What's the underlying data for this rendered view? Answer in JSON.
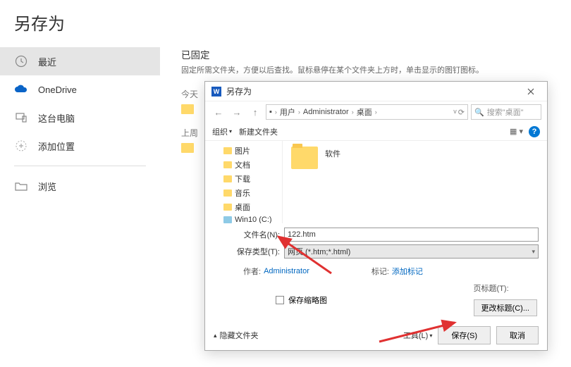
{
  "page": {
    "title": "另存为"
  },
  "sidebar": {
    "items": [
      {
        "label": "最近"
      },
      {
        "label": "OneDrive"
      },
      {
        "label": "这台电脑"
      },
      {
        "label": "添加位置"
      },
      {
        "label": "浏览"
      }
    ]
  },
  "right": {
    "pinned_title": "已固定",
    "pinned_sub": "固定所需文件夹，方便以后查找。鼠标悬停在某个文件夹上方时，单击显示的图钉图标。",
    "today": "今天",
    "lastweek": "上周"
  },
  "dialog": {
    "title": "另存为",
    "breadcrumb": [
      "用户",
      "Administrator",
      "桌面"
    ],
    "search_placeholder": "搜索\"桌面\"",
    "organize": "组织",
    "new_folder": "新建文件夹",
    "tree": [
      {
        "label": "图片"
      },
      {
        "label": "文档"
      },
      {
        "label": "下载"
      },
      {
        "label": "音乐"
      },
      {
        "label": "桌面"
      },
      {
        "label": "Win10 (C:)",
        "drive": true
      }
    ],
    "file_item": "软件",
    "filename_label": "文件名(N):",
    "filename_value": "122.htm",
    "savetype_label": "保存类型(T):",
    "savetype_value": "网页 (*.htm;*.html)",
    "author_label": "作者:",
    "author_value": "Administrator",
    "tag_label": "标记:",
    "tag_value": "添加标记",
    "save_thumb": "保存缩略图",
    "page_title_label": "页标题(T):",
    "change_title": "更改标题(C)...",
    "hide_folders": "隐藏文件夹",
    "tools": "工具(L)",
    "save_btn": "保存(S)",
    "cancel_btn": "取消"
  }
}
